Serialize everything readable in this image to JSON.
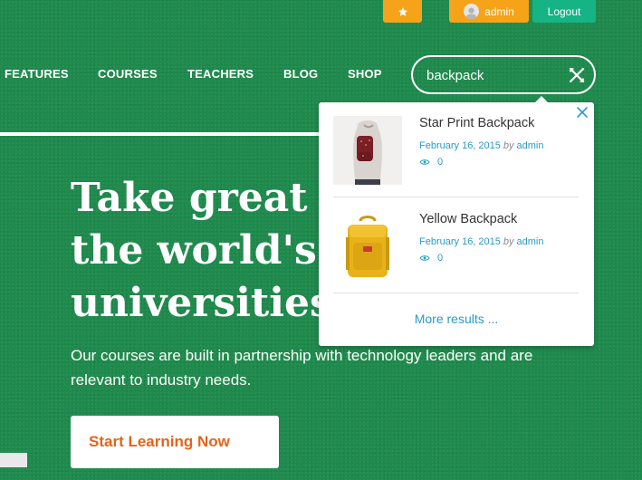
{
  "colors": {
    "background": "#1f8a4d",
    "accent_orange": "#f6a319",
    "logout_green": "#16b384",
    "cta_text": "#e4641a",
    "link_blue": "#2a9bc7"
  },
  "topbar": {
    "favorites_icon": "star-icon",
    "user_label": "admin",
    "logout_label": "Logout"
  },
  "nav": {
    "items": [
      "FEATURES",
      "COURSES",
      "TEACHERS",
      "BLOG",
      "SHOP"
    ]
  },
  "search": {
    "value": "backpack",
    "clear_icon": "clear-icon"
  },
  "hero": {
    "title_line1": "Take great c",
    "title_line2": "the world's b",
    "title_line3": "universities",
    "subtitle": "Our courses are built in partnership with technology leaders and are relevant to industry needs.",
    "cta_label": "Start Learning Now"
  },
  "dropdown": {
    "results": [
      {
        "title": "Star Print Backpack",
        "date": "February 16, 2015",
        "by": "by",
        "author": "admin",
        "views": "0"
      },
      {
        "title": "Yellow Backpack",
        "date": "February 16, 2015",
        "by": "by",
        "author": "admin",
        "views": "0"
      }
    ],
    "more_label": "More results ..."
  }
}
